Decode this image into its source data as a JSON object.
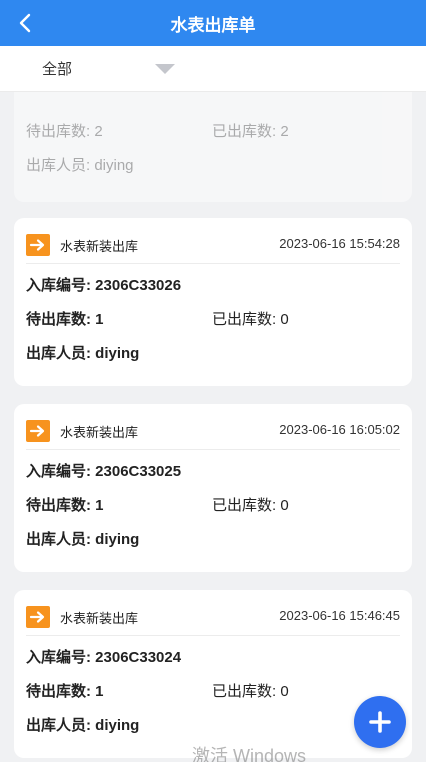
{
  "header": {
    "title": "水表出库单"
  },
  "filter": {
    "selected": "全部"
  },
  "partial_card": {
    "pending_label": "待出库数: 2",
    "shipped_label": "已出库数: 2",
    "operator_label": "出库人员: diying"
  },
  "cards": [
    {
      "type": "水表新装出库",
      "time": "2023-06-16 15:54:28",
      "inbound_no": "入库编号: 2306C33026",
      "pending": "待出库数: 1",
      "shipped": "已出库数: 0",
      "operator": "出库人员: diying"
    },
    {
      "type": "水表新装出库",
      "time": "2023-06-16 16:05:02",
      "inbound_no": "入库编号: 2306C33025",
      "pending": "待出库数: 1",
      "shipped": "已出库数: 0",
      "operator": "出库人员: diying"
    },
    {
      "type": "水表新装出库",
      "time": "2023-06-16 15:46:45",
      "inbound_no": "入库编号: 2306C33024",
      "pending": "待出库数: 1",
      "shipped": "已出库数: 0",
      "operator": "出库人员: diying"
    }
  ],
  "colors": {
    "primary": "#2f88f0",
    "fab": "#2f6ff0",
    "icon": "#f7931e"
  },
  "icons": {
    "back": "chevron-left-icon",
    "dropdown": "caret-down-icon",
    "type": "arrow-right-box-icon",
    "fab": "plus-icon"
  },
  "watermark": "激活 Windows"
}
